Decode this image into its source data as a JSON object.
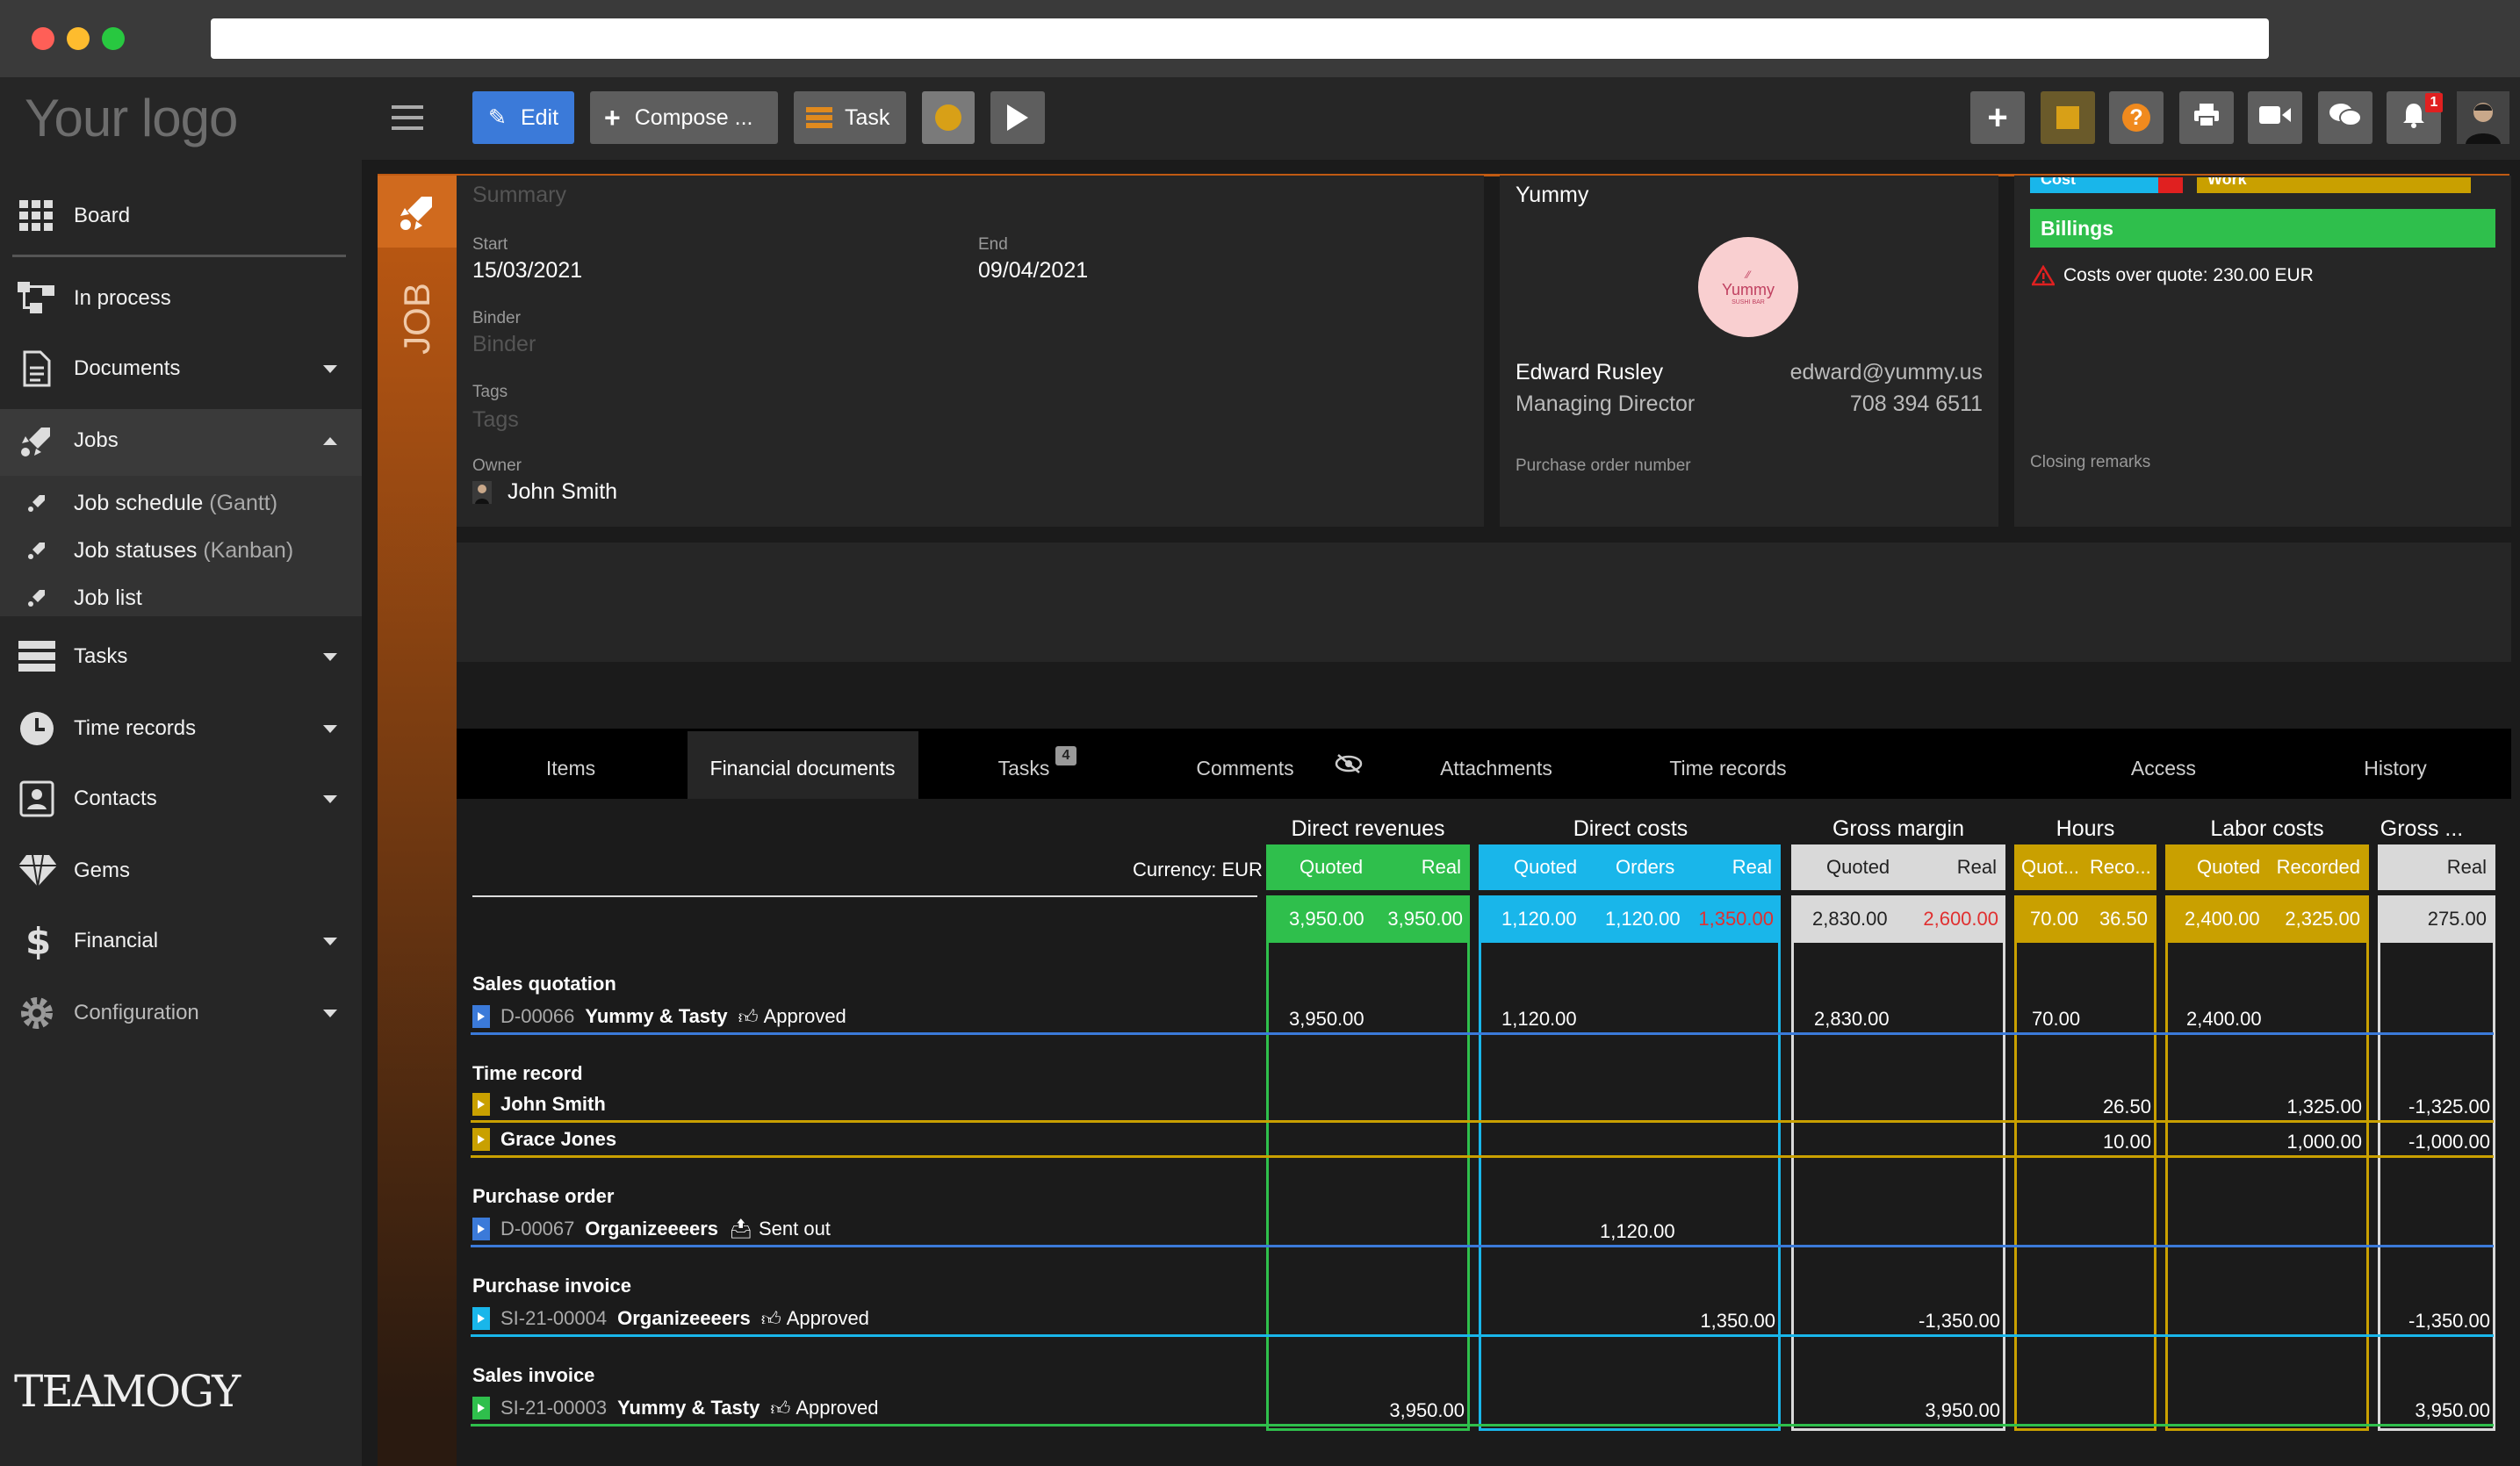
{
  "brand": {
    "logo_text": "Your logo",
    "footer_logo": "TEAMOGY"
  },
  "sidebar": {
    "items": [
      {
        "label": "Board"
      },
      {
        "label": "In process"
      },
      {
        "label": "Documents"
      },
      {
        "label": "Jobs"
      },
      {
        "label": "Tasks"
      },
      {
        "label": "Time records"
      },
      {
        "label": "Contacts"
      },
      {
        "label": "Gems"
      },
      {
        "label": "Financial"
      },
      {
        "label": "Configuration"
      }
    ],
    "jobs_sub": [
      {
        "label": "Job schedule",
        "suffix": "(Gantt)"
      },
      {
        "label": "Job statuses",
        "suffix": "(Kanban)"
      },
      {
        "label": "Job list",
        "suffix": ""
      }
    ]
  },
  "toolbar": {
    "edit": "Edit",
    "compose": "Compose ...",
    "task": "Task",
    "notification_count": "1"
  },
  "job": {
    "strip_label": "JOB",
    "summary_placeholder": "Summary",
    "start_label": "Start",
    "start": "15/03/2021",
    "end_label": "End",
    "end": "09/04/2021",
    "binder_label": "Binder",
    "binder_placeholder": "Binder",
    "tags_label": "Tags",
    "tags_placeholder": "Tags",
    "owner_label": "Owner",
    "owner": "John Smith"
  },
  "client": {
    "name": "Yummy",
    "logo_text": "Yummy",
    "logo_sub": "SUSHI BAR",
    "contact_name": "Edward Rusley",
    "contact_title": "Managing Director",
    "email": "edward@yummy.us",
    "phone": "708 394 6511",
    "po_label": "Purchase order number"
  },
  "status": {
    "bar1": "Cost",
    "bar2": "Work",
    "billings": "Billings",
    "warning": "Costs over quote: 230.00 EUR",
    "closing_label": "Closing remarks"
  },
  "tabs": {
    "items": "Items",
    "financial": "Financial documents",
    "tasks": "Tasks",
    "tasks_badge": "4",
    "comments": "Comments",
    "attachments": "Attachments",
    "time_records": "Time records",
    "access": "Access",
    "history": "History"
  },
  "financial": {
    "currency": "Currency: EUR",
    "groups": {
      "direct_revenues": "Direct revenues",
      "direct_costs": "Direct costs",
      "gross_margin": "Gross margin",
      "hours": "Hours",
      "labor_costs": "Labor costs",
      "gross": "Gross ..."
    },
    "sub": {
      "dr_quoted": "Quoted",
      "dr_real": "Real",
      "dc_quoted": "Quoted",
      "dc_orders": "Orders",
      "dc_real": "Real",
      "gm_quoted": "Quoted",
      "gm_real": "Real",
      "h_quoted": "Quot...",
      "h_recorded": "Reco...",
      "lc_quoted": "Quoted",
      "lc_recorded": "Recorded",
      "g_real": "Real"
    },
    "totals": {
      "dr_quoted": "3,950.00",
      "dr_real": "3,950.00",
      "dc_quoted": "1,120.00",
      "dc_orders": "1,120.00",
      "dc_real": "1,350.00",
      "gm_quoted": "2,830.00",
      "gm_real": "2,600.00",
      "h_quoted": "70.00",
      "h_recorded": "36.50",
      "lc_quoted": "2,400.00",
      "lc_recorded": "2,325.00",
      "g_real": "275.00"
    },
    "sections": {
      "sales_quotation": "Sales quotation",
      "time_record": "Time record",
      "purchase_order": "Purchase order",
      "purchase_invoice": "Purchase invoice",
      "sales_invoice": "Sales invoice"
    },
    "rows": {
      "sq": {
        "code": "D-00066",
        "party": "Yummy & Tasty",
        "status": "Approved",
        "dr_quoted": "3,950.00",
        "dc_quoted": "1,120.00",
        "gm_quoted": "2,830.00",
        "h_quoted": "70.00",
        "lc_quoted": "2,400.00"
      },
      "tr1": {
        "name": "John Smith",
        "h_recorded": "26.50",
        "lc_recorded": "1,325.00",
        "g_real": "-1,325.00"
      },
      "tr2": {
        "name": "Grace Jones",
        "h_recorded": "10.00",
        "lc_recorded": "1,000.00",
        "g_real": "-1,000.00"
      },
      "po": {
        "code": "D-00067",
        "party": "Organizeeeers",
        "status": "Sent out",
        "dc_orders": "1,120.00"
      },
      "pi": {
        "code": "SI-21-00004",
        "party": "Organizeeeers",
        "status": "Approved",
        "dc_real": "1,350.00",
        "gm_real": "-1,350.00",
        "g_real": "-1,350.00"
      },
      "si": {
        "code": "SI-21-00003",
        "party": "Yummy & Tasty",
        "status": "Approved",
        "dr_real": "3,950.00",
        "gm_real": "3,950.00",
        "g_real": "3,950.00"
      }
    }
  },
  "colors": {
    "green": "#2fbf4c",
    "blue": "#19b6ea",
    "gray": "#d9d9d9",
    "gold": "#c9a000",
    "orange": "#c05a12"
  }
}
